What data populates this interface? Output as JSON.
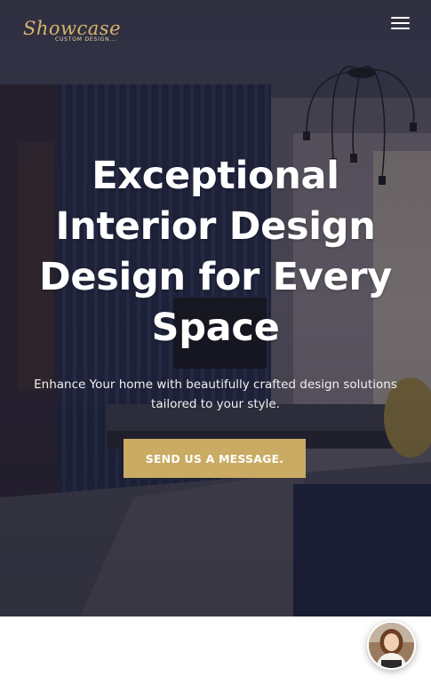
{
  "brand": {
    "logo_script": "Showcase",
    "logo_tagline": "CUSTOM DESIGN..."
  },
  "header": {
    "menu_icon": "hamburger-menu-icon"
  },
  "hero": {
    "headline_lines": [
      "Exceptional",
      "Interior Design",
      "Design for Every",
      "Space"
    ],
    "subtext_lines": [
      "Enhance Your home with beautifully crafted design solutions",
      "tailored to your style."
    ],
    "cta_label": "SEND US A MESSAGE."
  },
  "chat": {
    "avatar_icon": "support-agent-avatar"
  },
  "colors": {
    "accent_gold": "#c9ab63",
    "logo_gold": "#d7b46a",
    "overlay": "#1e1e2d"
  }
}
